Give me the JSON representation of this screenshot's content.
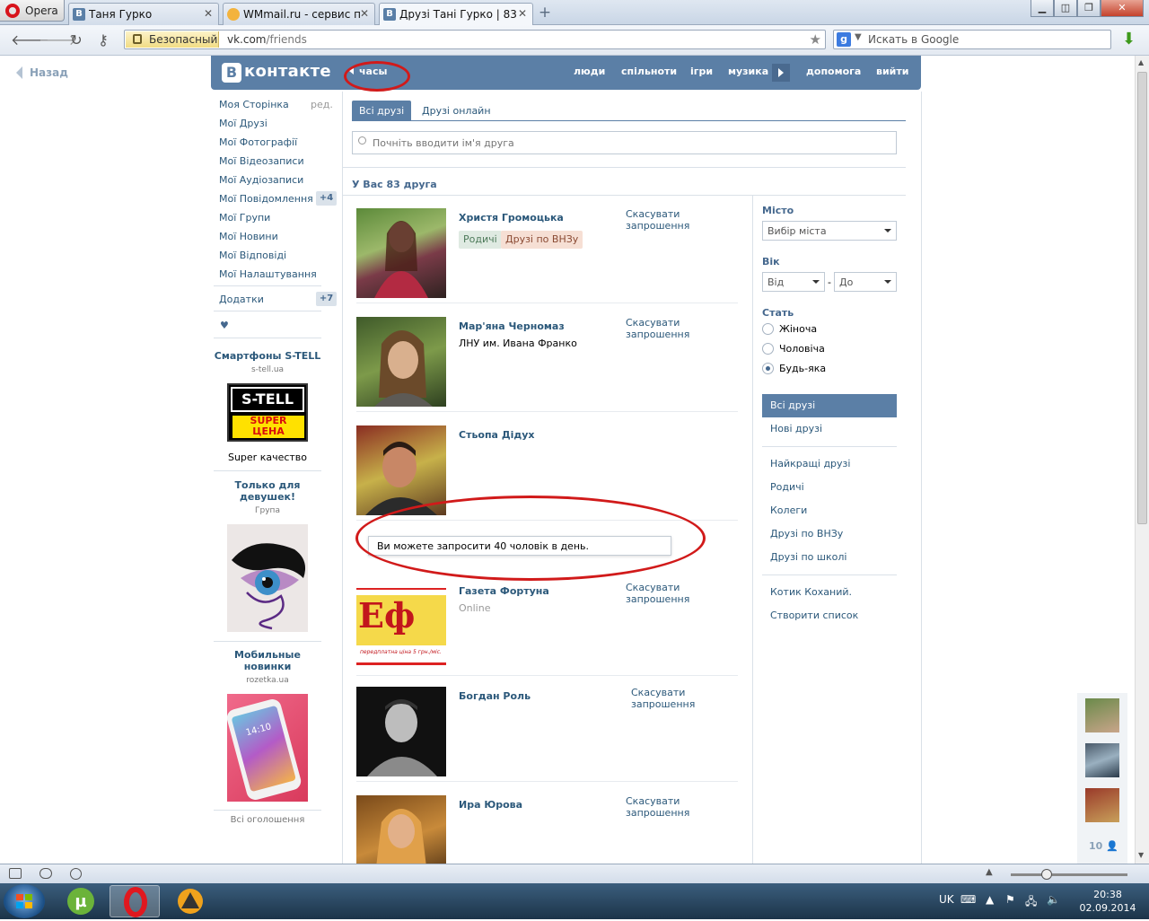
{
  "browser": {
    "menu_label": "Opera",
    "tabs": [
      {
        "favicon": "В",
        "title": "Таня Гурко"
      },
      {
        "favicon": "",
        "title": "WMmail.ru - сервис п..."
      },
      {
        "favicon": "В",
        "title": "Друзі Тані Гурко | 83 д..."
      }
    ],
    "secure_label": "Безопасный",
    "url_host": "vk.com",
    "url_path": "/friends",
    "search_placeholder": "Искать в Google",
    "search_engine_letter": "g"
  },
  "page": {
    "back_label": "Назад",
    "logo_letter": "В",
    "logo_text": "контакте",
    "status_text": "часы",
    "top_nav": [
      "люди",
      "спільноти",
      "ігри",
      "музика",
      "допомога",
      "вийти"
    ]
  },
  "left_menu": {
    "items": [
      "Моя Сторінка",
      "Мої Друзі",
      "Мої Фотографії",
      "Мої Відеозаписи",
      "Мої Аудіозаписи",
      "Мої Повідомлення",
      "Мої Групи",
      "Мої Новини",
      "Мої Відповіді",
      "Мої Налаштування"
    ],
    "edit_label": "ред.",
    "messages_badge": "+4",
    "apps_label": "Додатки",
    "apps_badge": "+7",
    "heart": "♥"
  },
  "ads": [
    {
      "title": "Смартфоны S-TELL",
      "sub": "s-tell.ua",
      "banner_top": "S-TELL",
      "banner_mid": "SUPER",
      "banner_bot": "ЦЕНА",
      "text": "Super качество"
    },
    {
      "title": "Только для девушек!",
      "sub": "Група"
    },
    {
      "title": "Мобильные новинки",
      "sub": "rozetka.ua",
      "phone_time": "14:10"
    }
  ],
  "ads_all_label": "Всі оголошення",
  "main": {
    "tabs": [
      "Всі друзі",
      "Друзі онлайн"
    ],
    "search_placeholder": "Почніть вводити ім'я друга",
    "count_text": "У Вас 83 друга",
    "friends": [
      {
        "name": "Христя Громоцька",
        "sub": "",
        "tags": [
          "Родичі",
          "Друзі по ВНЗу"
        ],
        "cancel": "Скасувати запрошення"
      },
      {
        "name": "Мар'яна Черномаз",
        "sub": "ЛНУ им. Ивана Франко",
        "tags": [],
        "cancel": "Скасувати запрошення"
      },
      {
        "name": "Стьопа Дідух",
        "sub": "",
        "tags": [],
        "cancel": ""
      },
      {
        "name": "Газета Фортуна",
        "sub": "Online",
        "tags": [],
        "cancel": "Скасувати запрошення",
        "logo_letters": "Еф",
        "logo_caption": "передплатна ціна 5 грн./міс."
      },
      {
        "name": "Богдан Роль",
        "sub": "",
        "tags": [],
        "cancel": "Скасувати запрошення"
      },
      {
        "name": "Ира Юрова",
        "sub": "",
        "tags": [],
        "cancel": "Скасувати запрошення"
      }
    ],
    "tooltip": "Ви можете запросити 40 чоловік в день."
  },
  "filters": {
    "city_title": "Місто",
    "city_value": "Вибір міста",
    "age_title": "Вік",
    "age_from": "Від",
    "age_dash": "-",
    "age_to": "До",
    "gender_title": "Стать",
    "gender_options": [
      "Жіноча",
      "Чоловіча",
      "Будь-яка"
    ],
    "gender_selected": 2,
    "lists": [
      "Всі друзі",
      "Нові друзі",
      "Найкращі друзі",
      "Родичі",
      "Колеги",
      "Друзі по ВНЗу",
      "Друзі по школі",
      "Котик Коханий.",
      "Створити список"
    ]
  },
  "online_sidebar": {
    "count": "10"
  },
  "taskbar": {
    "lang": "UK",
    "time": "20:38",
    "date": "02.09.2014"
  },
  "colors": {
    "vk_blue": "#5b7fa6",
    "link": "#2b587a",
    "annotation_red": "#d11a1a"
  }
}
